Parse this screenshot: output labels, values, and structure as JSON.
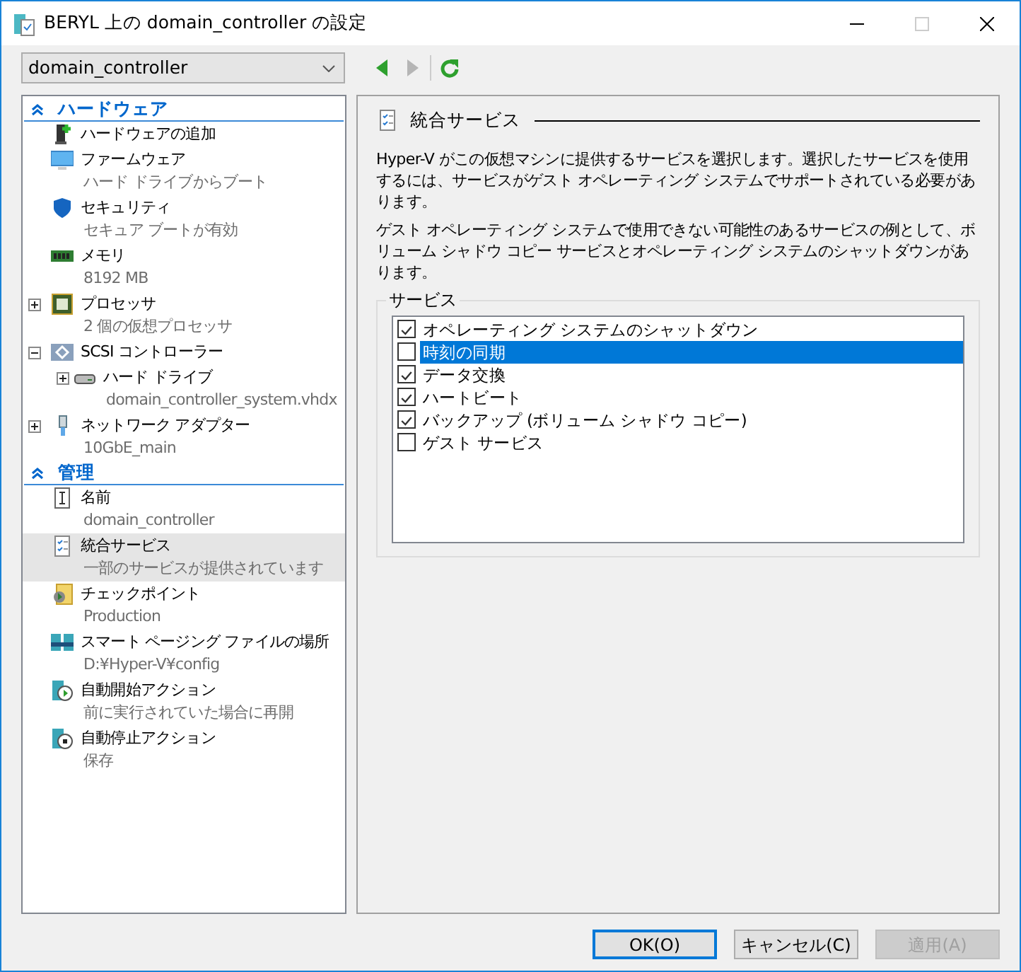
{
  "window": {
    "title": "BERYL 上の domain_controller の設定"
  },
  "vm_selector": {
    "value": "domain_controller"
  },
  "nav_buttons": [
    {
      "kind": "back",
      "disabled": false
    },
    {
      "kind": "forward",
      "disabled": true
    },
    {
      "kind": "refresh",
      "disabled": false
    }
  ],
  "tree": [
    {
      "kind": "section",
      "label": "ハードウェア",
      "expanded": true,
      "children": [
        {
          "label": "ハードウェアの追加",
          "selected": false
        },
        {
          "label": "ファームウェア",
          "detail": "ハード ドライブからブート",
          "selected": false
        },
        {
          "label": "セキュリティ",
          "detail": "セキュア ブートが有効",
          "selected": false
        },
        {
          "label": "メモリ",
          "detail": "8192 MB",
          "selected": false
        },
        {
          "label": "プロセッサ",
          "detail": "2 個の仮想プロセッサ",
          "expanded": false,
          "selected": false
        },
        {
          "label": "SCSI コントローラー",
          "expanded": true,
          "selected": false,
          "children": [
            {
              "label": "ハード ドライブ",
              "detail": "domain_controller_system.vhdx",
              "expanded": false,
              "selected": false
            }
          ]
        },
        {
          "label": "ネットワーク アダプター",
          "detail": "10GbE_main",
          "expanded": false,
          "selected": false
        }
      ]
    },
    {
      "kind": "section",
      "label": "管理",
      "expanded": true,
      "children": [
        {
          "label": "名前",
          "detail": "domain_controller",
          "selected": false
        },
        {
          "label": "統合サービス",
          "detail": "一部のサービスが提供されています",
          "selected": true
        },
        {
          "label": "チェックポイント",
          "detail": "Production",
          "selected": false
        },
        {
          "label": "スマート ページング ファイルの場所",
          "detail": "D:¥Hyper-V¥config",
          "selected": false
        },
        {
          "label": "自動開始アクション",
          "detail": "前に実行されていた場合に再開",
          "selected": false
        },
        {
          "label": "自動停止アクション",
          "detail": "保存",
          "selected": false
        }
      ]
    }
  ],
  "panel": {
    "title": "統合サービス",
    "paragraphs": [
      "Hyper-V がこの仮想マシンに提供するサービスを選択します。選択したサービスを使用するには、サービスがゲスト オペレーティング システムでサポートされている必要があります。",
      "ゲスト オペレーティング システムで使用できない可能性のあるサービスの例として、ボリューム シャドウ コピー サービスとオペレーティング システムのシャットダウンがあります。"
    ],
    "group_label": "サービス",
    "services": [
      {
        "label": "オペレーティング システムのシャットダウン",
        "checked": true,
        "selected": false
      },
      {
        "label": "時刻の同期",
        "checked": false,
        "selected": true
      },
      {
        "label": "データ交換",
        "checked": true,
        "selected": false
      },
      {
        "label": "ハートビート",
        "checked": true,
        "selected": false
      },
      {
        "label": "バックアップ (ボリューム シャドウ コピー)",
        "checked": true,
        "selected": false
      },
      {
        "label": "ゲスト サービス",
        "checked": false,
        "selected": false
      }
    ]
  },
  "buttons": [
    {
      "label": "OK(O)",
      "kind": "default",
      "disabled": false
    },
    {
      "label": "キャンセル(C)",
      "kind": "normal",
      "disabled": false
    },
    {
      "label": "適用(A)",
      "kind": "normal",
      "disabled": true
    }
  ]
}
